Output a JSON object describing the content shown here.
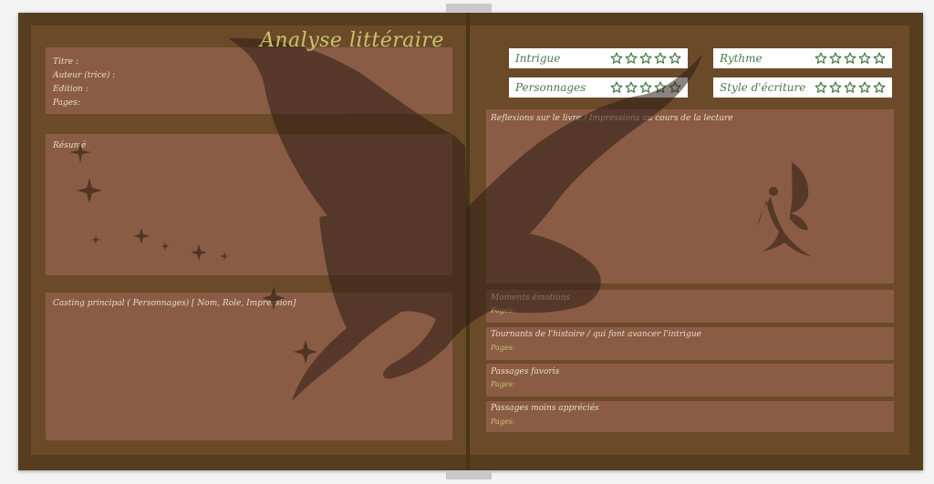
{
  "title": "Analyse littéraire",
  "book_info": {
    "titre": "Titre :",
    "auteur": "Auteur (trice) :",
    "edition": "Edition :",
    "pages": "Pages:"
  },
  "resume_label": "Résumé",
  "casting_label": "Casting principal ( Personnages) [ Nom, Role, Impression]",
  "ratings": [
    {
      "label": "Intrigue",
      "stars": 5
    },
    {
      "label": "Rythme",
      "stars": 5
    },
    {
      "label": "Personnages",
      "stars": 5
    },
    {
      "label": "Style d'écriture",
      "stars": 5
    }
  ],
  "reflexions_label": "Reflexions sur le livre / Impressions au cours de la lecture",
  "sections": [
    {
      "label": "Moments émotions",
      "pages": "Pages:"
    },
    {
      "label": "Tournants de l'histoire / qui font avancer l'intrigue",
      "pages": "Pages:"
    },
    {
      "label": "Passages favoris",
      "pages": "Pages:"
    },
    {
      "label": "Passages moins appréciés",
      "pages": "Pages:"
    }
  ],
  "colors": {
    "frame": "#563d1f",
    "page": "#6b4a2a",
    "panel": "#8a5c45",
    "accent_gold": "#c9c46a",
    "rating_green": "#4a7a4a"
  },
  "icons": [
    "dragon-silhouette-icon",
    "fairy-icon",
    "sparkle-star-icon",
    "outline-star-icon"
  ]
}
